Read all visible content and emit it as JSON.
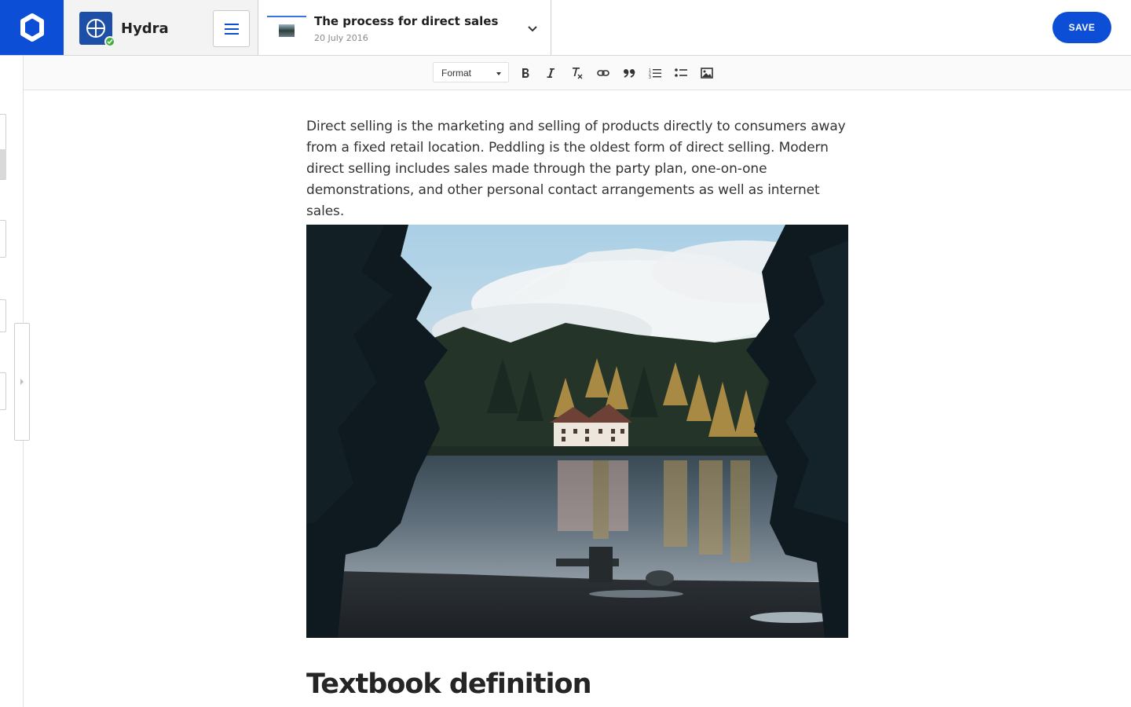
{
  "header": {
    "site": {
      "name": "Hydra"
    },
    "document": {
      "title": "The process for direct sales",
      "date": "20 July 2016"
    },
    "save_label": "SAVE"
  },
  "toolbar": {
    "format_label": "Format",
    "buttons": [
      "bold-icon",
      "italic-icon",
      "clear-format-icon",
      "link-icon",
      "blockquote-icon",
      "numbered-list-icon",
      "bulleted-list-icon",
      "image-icon"
    ]
  },
  "content": {
    "paragraph": "Direct selling is the marketing and selling of products directly to consumers away from a fixed retail location. Peddling is the oldest form of direct selling. Modern direct selling includes sales made through the party plan, one-on-one demonstrations, and other personal contact arrangements as well as internet sales.",
    "image_subject": "lake-house-photo",
    "heading": "Textbook definition"
  },
  "colors": {
    "accent": "#0c4fd6",
    "status_ok": "#3fae3a"
  }
}
